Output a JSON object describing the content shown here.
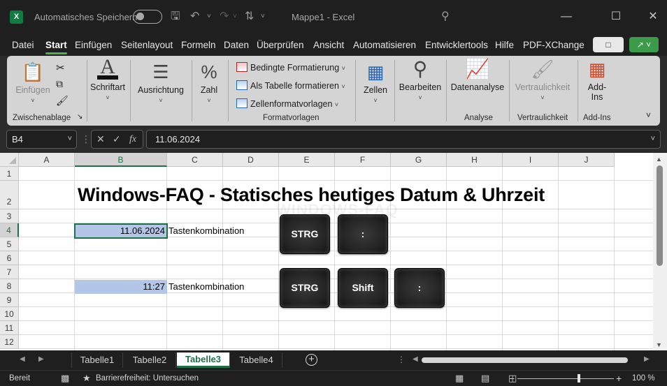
{
  "titlebar": {
    "autosave_label": "Automatisches Speichern",
    "doc_title": "Mappe1  -  Excel",
    "logo_letter": "X"
  },
  "menu": {
    "items": [
      "Datei",
      "Start",
      "Einfügen",
      "Seitenlayout",
      "Formeln",
      "Daten",
      "Überprüfen",
      "Ansicht",
      "Automatisieren",
      "Entwicklertools",
      "Hilfe",
      "PDF-XChange"
    ],
    "active": "Start"
  },
  "ribbon": {
    "clipboard": {
      "paste_label": "Einfügen",
      "group_label": "Zwischenablage"
    },
    "font": {
      "label": "Schriftart"
    },
    "alignment": {
      "label": "Ausrichtung"
    },
    "number": {
      "label": "Zahl"
    },
    "styles": {
      "conditional": "Bedingte Formatierung",
      "as_table": "Als Tabelle formatieren",
      "cell_styles": "Zellenformatvorlagen",
      "group_label": "Formatvorlagen"
    },
    "cells": {
      "label": "Zellen"
    },
    "editing": {
      "label": "Bearbeiten"
    },
    "analysis": {
      "label": "Datenanalyse",
      "group_label": "Analyse"
    },
    "sensitivity": {
      "label": "Vertraulichkeit",
      "group_label": "Vertraulichkeit"
    },
    "addins": {
      "label_line1": "Add-",
      "label_line2": "Ins",
      "group_label": "Add-Ins"
    }
  },
  "formula_bar": {
    "name_box": "B4",
    "fx": "fx",
    "value": "11.06.2024"
  },
  "grid": {
    "columns": [
      "A",
      "B",
      "C",
      "D",
      "E",
      "F",
      "G",
      "H",
      "I",
      "J"
    ],
    "rows": [
      "1",
      "2",
      "3",
      "4",
      "5",
      "6",
      "7",
      "8",
      "9",
      "10",
      "11",
      "12"
    ],
    "selected_column": "B",
    "selected_row": "4",
    "title": "Windows-FAQ - Statisches heutiges Datum & Uhrzeit",
    "date_value": "11.06.2024",
    "time_value": "11:27",
    "label_1": "Tastenkombination",
    "label_2": "Tastenkombination",
    "keys_row_1": [
      "STRG",
      ":"
    ],
    "keys_row_2": [
      "STRG",
      "Shift",
      ":"
    ],
    "watermark": "WINDOWS-FAQ"
  },
  "sheets": {
    "tabs": [
      "Tabelle1",
      "Tabelle2",
      "Tabelle3",
      "Tabelle4"
    ],
    "active": "Tabelle3"
  },
  "status": {
    "ready": "Bereit",
    "accessibility": "Barrierefreiheit: Untersuchen",
    "zoom": "100 %"
  }
}
